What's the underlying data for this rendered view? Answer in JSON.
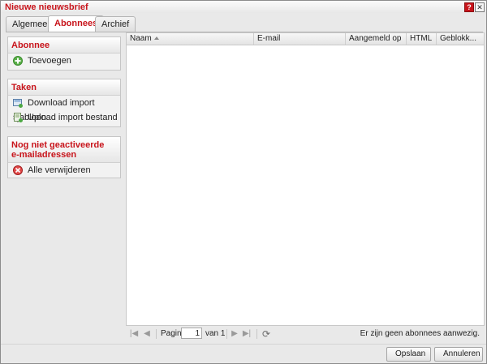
{
  "window": {
    "title": "Nieuwe nieuwsbrief",
    "help_label": "?",
    "close_label": "✕"
  },
  "tabs": [
    {
      "label": "Algemeen",
      "active": false
    },
    {
      "label": "Abonnees",
      "active": true
    },
    {
      "label": "Archief",
      "active": false
    }
  ],
  "sidebar": {
    "subscriber": {
      "title": "Abonnee",
      "items": [
        {
          "label": "Toevoegen",
          "icon": "add-circle-icon"
        }
      ]
    },
    "tasks": {
      "title": "Taken",
      "items": [
        {
          "label": "Download import sjabloon",
          "icon": "download-template-icon"
        },
        {
          "label": "Upload import bestand",
          "icon": "upload-file-icon"
        }
      ]
    },
    "inactive": {
      "title_line1": "Nog niet geactiveerde",
      "title_line2": "e-mailadressen",
      "items": [
        {
          "label": "Alle verwijderen",
          "icon": "delete-circle-icon"
        }
      ]
    }
  },
  "grid": {
    "columns": [
      "Naam",
      "E-mail",
      "Aangemeld op",
      "HTML",
      "Geblokk..."
    ],
    "rows": []
  },
  "pager": {
    "page_label": "Pagina",
    "page_value": "1",
    "of_label": "van 1",
    "status": "Er zijn geen abonnees aanwezig."
  },
  "footer": {
    "save_label": "Opslaan",
    "cancel_label": "Annuleren"
  },
  "colors": {
    "accent": "#c8141b",
    "background": "#e9e9e9"
  }
}
